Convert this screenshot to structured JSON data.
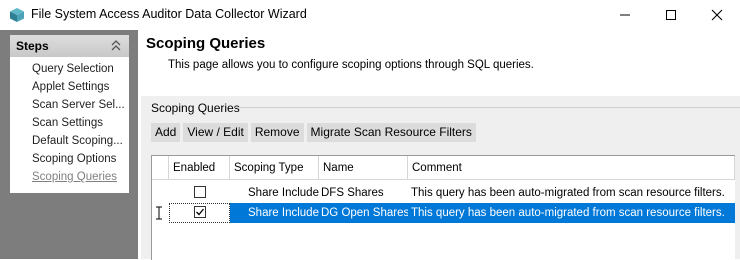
{
  "window": {
    "title": "File System Access Auditor Data Collector Wizard",
    "icon": "app-cube-icon",
    "controls": [
      "minimize-icon",
      "maximize-icon",
      "close-icon"
    ]
  },
  "steps": {
    "header": "Steps",
    "items": [
      {
        "label": "Query Selection",
        "active": false
      },
      {
        "label": "Applet Settings",
        "active": false
      },
      {
        "label": "Scan Server Sel...",
        "active": false
      },
      {
        "label": "Scan Settings",
        "active": false
      },
      {
        "label": "Default Scoping...",
        "active": false
      },
      {
        "label": "Scoping Options",
        "active": false
      },
      {
        "label": "Scoping Queries",
        "active": true
      }
    ]
  },
  "page": {
    "title": "Scoping Queries",
    "description": "This page allows you to configure scoping options through SQL queries."
  },
  "scoping": {
    "group_label": "Scoping Queries",
    "toolbar": [
      "Add",
      "View / Edit",
      "Remove",
      "Migrate Scan Resource Filters"
    ],
    "columns": [
      "Enabled",
      "Scoping Type",
      "Name",
      "Comment"
    ],
    "rows": [
      {
        "enabled": false,
        "type": "Share Include",
        "name": "DFS Shares",
        "comment": "This query has been auto-migrated from scan resource filters.",
        "selected": false
      },
      {
        "enabled": true,
        "type": "Share Include",
        "name": "DG Open Shares",
        "comment": "This query has been auto-migrated from scan resource filters.",
        "selected": true
      }
    ]
  },
  "colors": {
    "selection": "#0078d7",
    "left_pane": "#7d7d7d",
    "content_bg": "#efefef"
  }
}
